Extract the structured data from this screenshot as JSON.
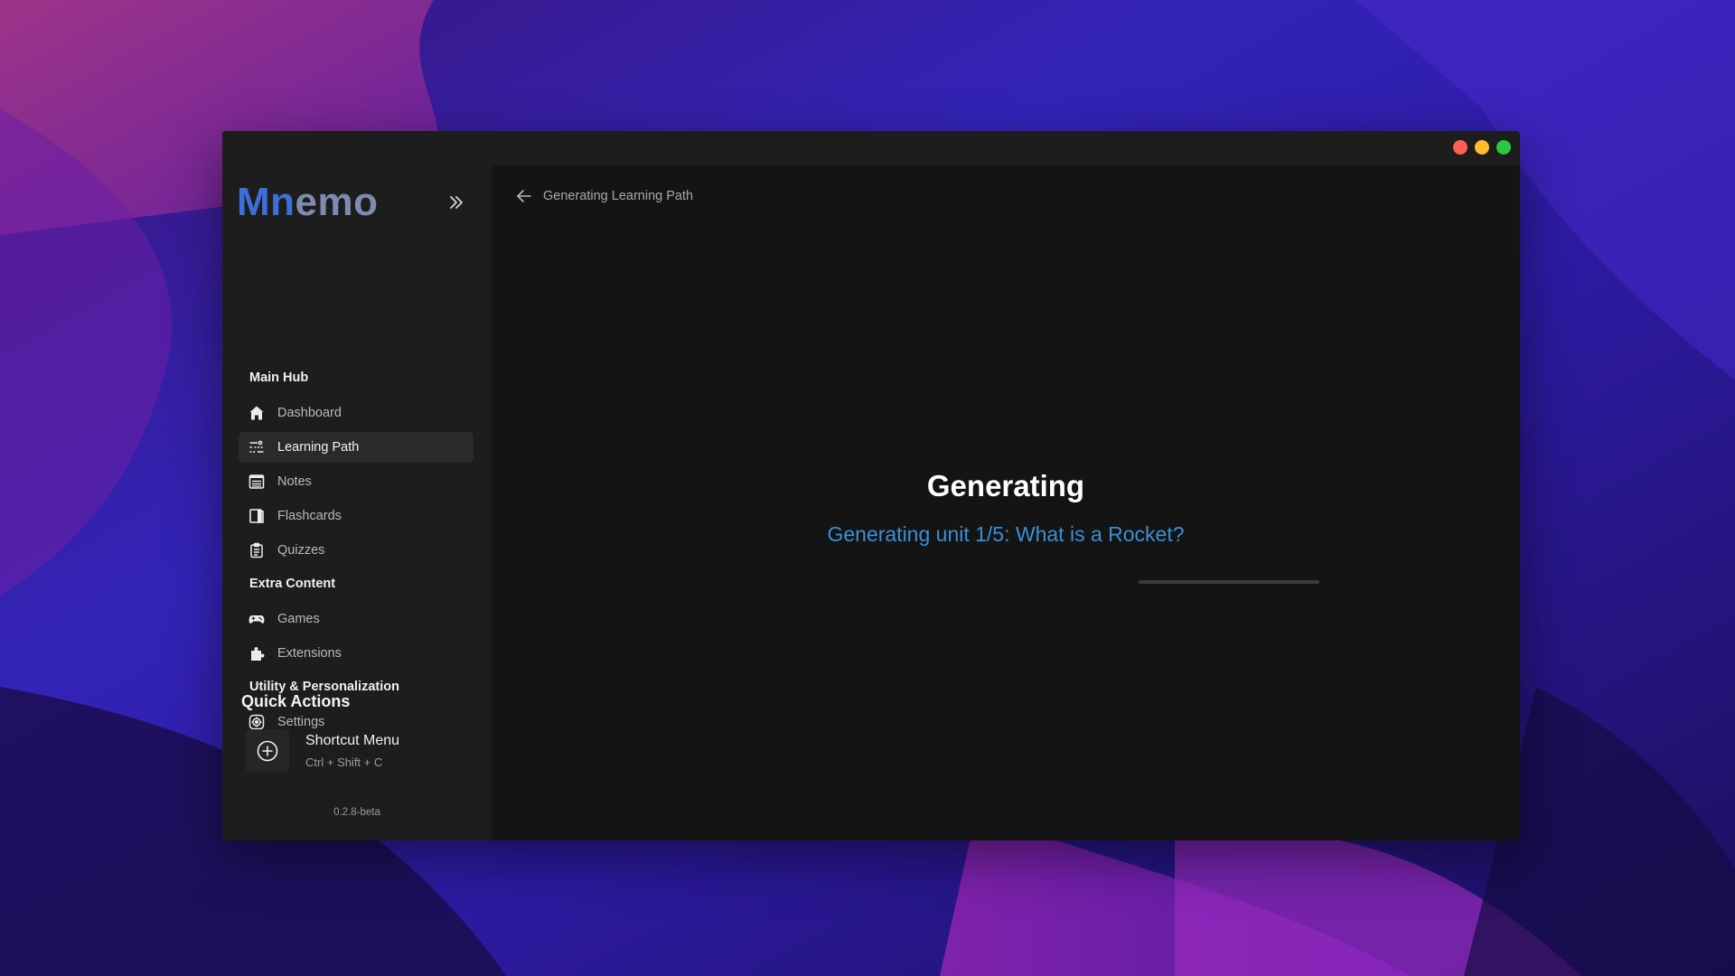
{
  "app": {
    "logo_part1": "Mn",
    "logo_part2": "emo",
    "version": "0.2.8-beta"
  },
  "colors": {
    "accent_blue": "#3b8fd6",
    "logo_blue": "#3c6fd8",
    "traffic_red": "#ff5f57",
    "traffic_yellow": "#febc2e",
    "traffic_green": "#28c840"
  },
  "sidebar": {
    "sections": [
      {
        "title": "Main Hub",
        "items": [
          {
            "label": "Dashboard",
            "icon": "home-icon"
          },
          {
            "label": "Learning Path",
            "icon": "path-icon",
            "active": true
          },
          {
            "label": "Notes",
            "icon": "notes-icon"
          },
          {
            "label": "Flashcards",
            "icon": "flashcards-icon"
          },
          {
            "label": "Quizzes",
            "icon": "clipboard-icon"
          }
        ]
      },
      {
        "title": "Extra Content",
        "items": [
          {
            "label": "Games",
            "icon": "gamepad-icon"
          },
          {
            "label": "Extensions",
            "icon": "puzzle-icon"
          }
        ]
      },
      {
        "title": "Utility & Personalization",
        "items": [
          {
            "label": "Settings",
            "icon": "settings-icon"
          }
        ]
      }
    ],
    "quick_actions": {
      "title": "Quick Actions",
      "items": [
        {
          "name": "Shortcut Menu",
          "shortcut": "Ctrl + Shift + C",
          "icon": "plus-circle-icon"
        }
      ]
    }
  },
  "main": {
    "breadcrumb": "Generating Learning Path",
    "heading": "Generating",
    "status": "Generating unit 1/5: What is a Rocket?",
    "progress_fraction": 0.0
  }
}
